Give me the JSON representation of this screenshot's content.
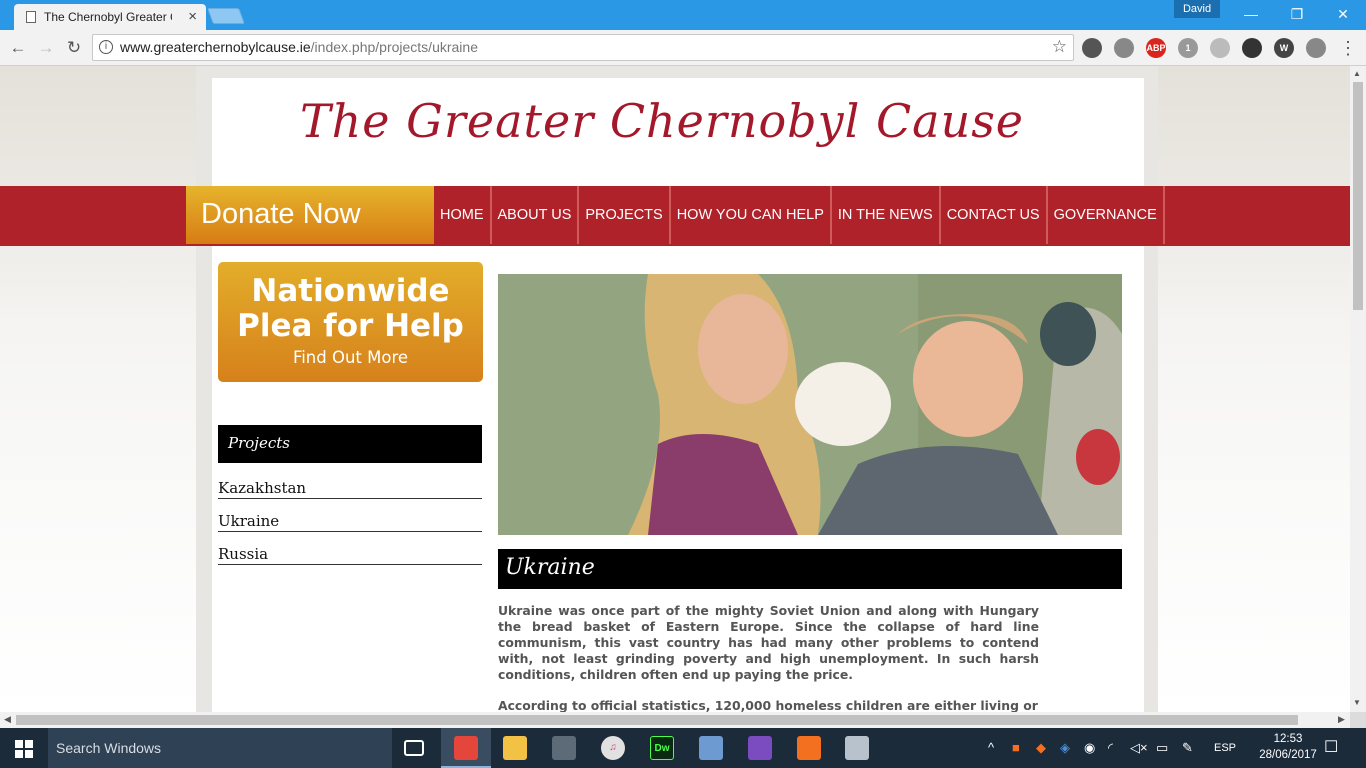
{
  "browser": {
    "tab_title": "The Chernobyl Greater C",
    "tab_close": "×",
    "user": "David",
    "url_domain": "www.greaterchernobylcause.ie",
    "url_path": "/index.php/projects/ukraine",
    "window_controls": {
      "minimize": "—",
      "maximize": "❐",
      "close": "✕"
    },
    "extensions": [
      {
        "name": "mail-icon",
        "label": "",
        "color": "#555"
      },
      {
        "name": "cube-extension-icon",
        "label": "",
        "color": "#888"
      },
      {
        "name": "adblock-plus-icon",
        "label": "ABP",
        "color": "#d9251d"
      },
      {
        "name": "tools-extension-icon",
        "label": "1",
        "color": "#999"
      },
      {
        "name": "settings-extension-icon",
        "label": "",
        "color": "#bbb"
      },
      {
        "name": "gear-icon",
        "label": "",
        "color": "#333"
      },
      {
        "name": "w-extension-icon",
        "label": "W",
        "color": "#444"
      },
      {
        "name": "bolt-extension-icon",
        "label": "",
        "color": "#888"
      }
    ]
  },
  "site": {
    "title": "The Greater Chernobyl Cause",
    "donate_label": "Donate Now",
    "nav": [
      "HOME",
      "ABOUT US",
      "PROJECTS",
      "HOW YOU CAN HELP",
      "IN THE NEWS",
      "CONTACT US",
      "GOVERNANCE"
    ],
    "plea": {
      "line1": "Nationwide",
      "line2": "Plea for Help",
      "cta": "Find Out More"
    },
    "sidebar": {
      "heading": "Projects",
      "items": [
        "Kazakhstan",
        "Ukraine",
        "Russia"
      ]
    },
    "content": {
      "heading": "Ukraine",
      "paragraph1": "Ukraine was once part of the mighty Soviet Union and along with Hungary the bread basket of Eastern Europe. Since the collapse of hard line communism, this vast country has had many other problems to contend with, not least grinding poverty and high unemployment. In such harsh conditions, children often end up paying the price.",
      "paragraph2": "According to official statistics, 120,000 homeless children are either living or"
    }
  },
  "taskbar": {
    "search_placeholder": "Search Windows",
    "apps": [
      {
        "name": "task-view-icon",
        "label": "",
        "color": "transparent"
      },
      {
        "name": "chrome-icon",
        "label": "",
        "color": "#e4463b"
      },
      {
        "name": "file-explorer-icon",
        "label": "",
        "color": "#f3c244"
      },
      {
        "name": "store-icon",
        "label": "",
        "color": "#5d6a78"
      },
      {
        "name": "itunes-icon",
        "label": "♫",
        "color": "#e1e1e1"
      },
      {
        "name": "dreamweaver-icon",
        "label": "Dw",
        "color": "#0a2a12"
      },
      {
        "name": "virtualbox-icon",
        "label": "",
        "color": "#6d9ad0"
      },
      {
        "name": "visual-studio-icon",
        "label": "",
        "color": "#7a4cc0"
      },
      {
        "name": "xampp-icon",
        "label": "",
        "color": "#f37021"
      },
      {
        "name": "network-app-icon",
        "label": "",
        "color": "#b8c2cc"
      }
    ],
    "language": "ESP",
    "time": "12:53",
    "date": "28/06/2017"
  }
}
